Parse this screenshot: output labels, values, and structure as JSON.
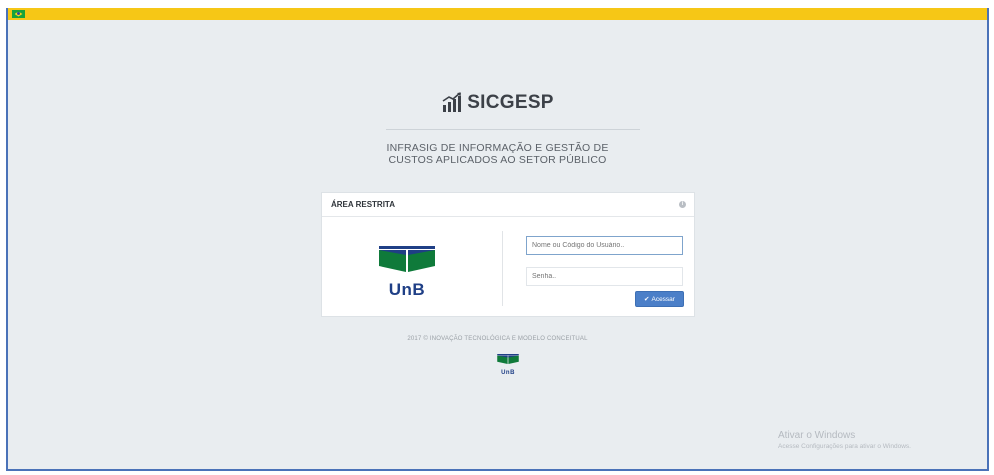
{
  "app": {
    "name": "SICGESP",
    "subtitle_line1": "INFRASIG DE INFORMAÇÃO E GESTÃO DE",
    "subtitle_line2": "CUSTOS APLICADOS AO SETOR PÚBLICO"
  },
  "login": {
    "title": "ÁREA RESTRITA",
    "info_icon": "i",
    "logo_text": "UnB",
    "username_placeholder": "Nome ou Código do Usuário..",
    "password_placeholder": "Senha..",
    "submit_icon": "✔",
    "submit_label": "Acessar"
  },
  "footer": {
    "text": "2017 © INOVAÇÃO TECNOLÓGICA E MODELO CONCEITUAL",
    "logo_text": "UnB"
  },
  "watermark": {
    "title": "Ativar o Windows",
    "subtitle": "Acesse Configurações para ativar o Windows."
  },
  "colors": {
    "top_bar": "#f6c716",
    "background": "#e9edf0",
    "button": "#4b7fc8",
    "unb_green": "#0f7a3a",
    "unb_blue": "#1f3f86",
    "frame_border": "#4a72b8"
  }
}
